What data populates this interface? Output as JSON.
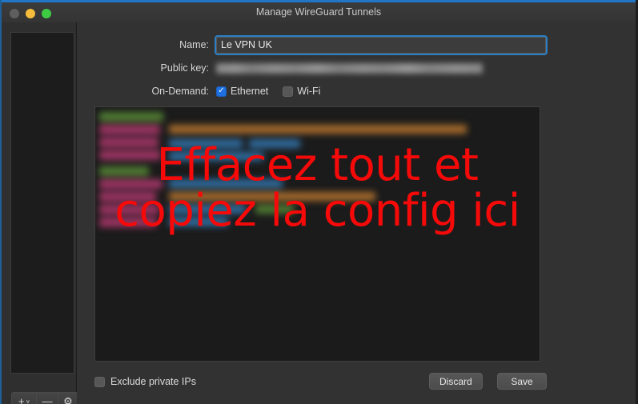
{
  "window": {
    "title": "Manage WireGuard Tunnels",
    "traffic_lights": [
      "close",
      "minimize",
      "zoom"
    ],
    "accent_color": "#2176c7"
  },
  "sidebar": {
    "tunnel_list_items": [],
    "toolbar": {
      "add_label": "+",
      "add_chevron": "˅",
      "remove_label": "—",
      "settings_icon": "⚙"
    }
  },
  "form": {
    "name": {
      "label": "Name:",
      "value": "Le VPN UK",
      "placeholder": ""
    },
    "public_key": {
      "label": "Public key:",
      "value": "",
      "redacted": true
    },
    "on_demand": {
      "label": "On-Demand:",
      "options": [
        {
          "label": "Ethernet",
          "checked": true,
          "check_glyph": "✓"
        },
        {
          "label": "Wi-Fi",
          "checked": false,
          "check_glyph": ""
        }
      ]
    }
  },
  "config_editor": {
    "redacted": true,
    "overlay_annotation": "Effacez tout et copiez la config ici",
    "overlay_color": "#f60a09",
    "syntax_colors": {
      "section": "#4f7a32",
      "key": "#9c3462",
      "value_blue": "#2f6b9e",
      "value_orange": "#a56a2c"
    }
  },
  "bottom_bar": {
    "exclude_private_ips": {
      "label": "Exclude private IPs",
      "checked": false
    },
    "discard_label": "Discard",
    "save_label": "Save"
  }
}
